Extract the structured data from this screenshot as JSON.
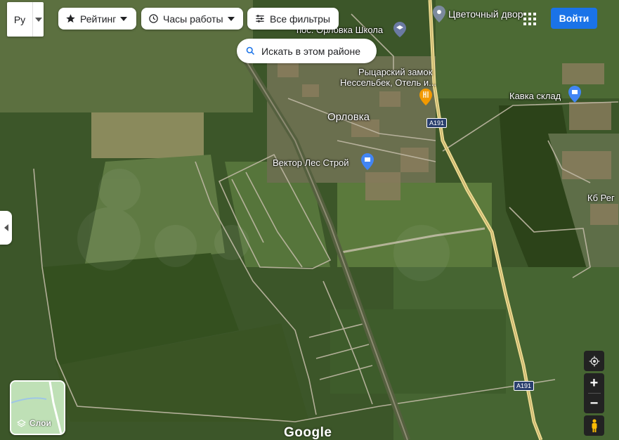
{
  "map": {
    "colors": {
      "forest": "#3f5a2c",
      "field": "#6b7e48",
      "road": "#e0d9c4",
      "highway": "#e8d48a"
    },
    "labels": [
      {
        "text": "пос. Орловка Школа",
        "name": "place-label-school"
      },
      {
        "text": "Цветочный двор",
        "name": "place-label-flower"
      },
      {
        "text": "Рыцарский замок",
        "name": "place-label-castle-1"
      },
      {
        "text": "Нессельбек, Отель и...",
        "name": "place-label-castle-2"
      },
      {
        "text": "Орловка",
        "name": "place-label-orlovka"
      },
      {
        "text": "Кавка склад",
        "name": "place-label-kavka"
      },
      {
        "text": "Вектор Лес Строй",
        "name": "place-label-vektor"
      },
      {
        "text": "Кб Рег",
        "name": "place-label-kb"
      }
    ],
    "road_shields": [
      "A191",
      "A191"
    ]
  },
  "lang": {
    "code": "Ру"
  },
  "filters": [
    {
      "label": "Рейтинг",
      "icon": "star-icon"
    },
    {
      "label": "Часы работы",
      "icon": "clock-icon"
    },
    {
      "label": "Все фильтры",
      "icon": "sliders-icon"
    }
  ],
  "search_area": {
    "label": "Искать в этом районе"
  },
  "header": {
    "login_label": "Войти"
  },
  "layers": {
    "label": "Слои"
  },
  "controls": {
    "zoom_in": "+",
    "zoom_out": "−"
  },
  "logo": "Google"
}
